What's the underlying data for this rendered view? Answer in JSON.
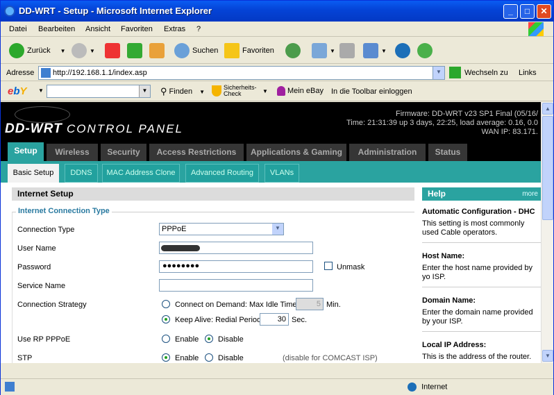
{
  "window": {
    "title": "DD-WRT - Setup - Microsoft Internet Explorer"
  },
  "menu": [
    "Datei",
    "Bearbeiten",
    "Ansicht",
    "Favoriten",
    "Extras",
    "?"
  ],
  "toolbar": {
    "back": "Zurück",
    "search": "Suchen",
    "favorites": "Favoriten"
  },
  "address": {
    "label": "Adresse",
    "url": "http://192.168.1.1/index.asp",
    "go": "Wechseln zu",
    "links": "Links"
  },
  "ebay_bar": {
    "logo": "ebY",
    "find": "Finden",
    "check": "Sicherheits-Check",
    "my_ebay": "Mein eBay",
    "login": "In die Toolbar einloggen"
  },
  "header": {
    "brand": "DD-WRT",
    "brand_sub": "CONTROL PANEL",
    "firmware": "Firmware: DD-WRT v23 SP1 Final (05/16/",
    "time": "Time: 21:31:39 up 3 days, 22:25, load average: 0.16, 0.0",
    "wan": "WAN IP: 83.171."
  },
  "tabs": [
    "Setup",
    "Wireless",
    "Security",
    "Access Restrictions",
    "Applications & Gaming",
    "Administration",
    "Status"
  ],
  "subtabs": [
    "Basic Setup",
    "DDNS",
    "MAC Address Clone",
    "Advanced Routing",
    "VLANs"
  ],
  "section": {
    "title": "Internet Setup",
    "legend": "Internet Connection Type"
  },
  "form": {
    "connection_type_label": "Connection Type",
    "connection_type_value": "PPPoE",
    "username_label": "User Name",
    "password_label": "Password",
    "password_value": "●●●●●●●●",
    "unmask": "Unmask",
    "service_label": "Service Name",
    "strategy_label": "Connection Strategy",
    "demand": "Connect on Demand: Max Idle Time",
    "idle_value": "5",
    "min": "Min.",
    "keepalive": "Keep Alive: Redial Period",
    "redial_value": "30",
    "sec": "Sec.",
    "rp_label": "Use RP PPPoE",
    "enable": "Enable",
    "disable": "Disable",
    "stp_label": "STP",
    "stp_note": "(disable for COMCAST ISP)"
  },
  "help": {
    "title": "Help",
    "more": "more",
    "items": [
      {
        "title": "Automatic Configuration - DHC",
        "text": "This setting is most commonly used Cable operators."
      },
      {
        "title": "Host Name:",
        "text": "Enter the host name provided by yo ISP."
      },
      {
        "title": "Domain Name:",
        "text": "Enter the domain name provided by your ISP."
      },
      {
        "title": "Local IP Address:",
        "text": "This is the address of the router."
      }
    ]
  },
  "status": {
    "zone": "Internet"
  }
}
